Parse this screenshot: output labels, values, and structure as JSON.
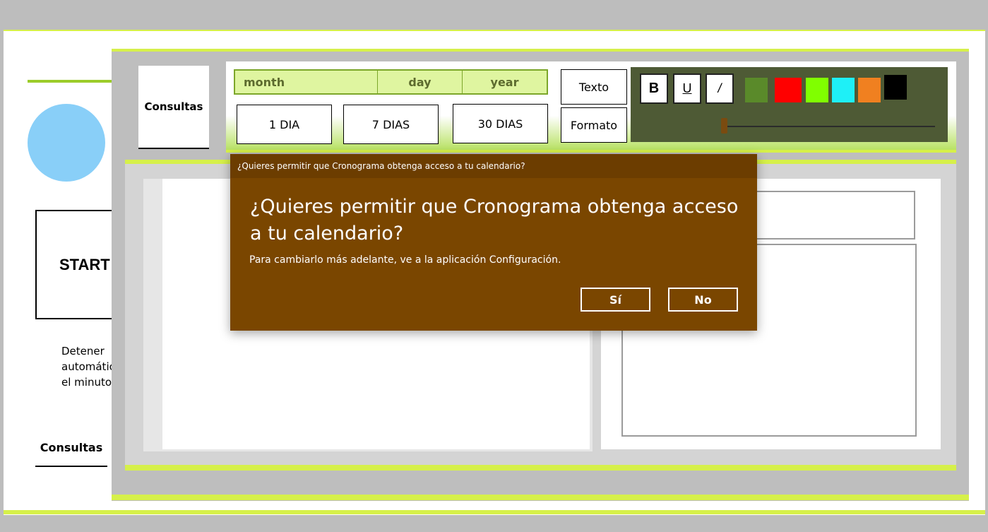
{
  "left_nav": {
    "start_label": "START",
    "stop_text": "Detener automático en el minuto",
    "consultas_label": "Consultas"
  },
  "panel": {
    "consultas_label": "Consultas"
  },
  "toolbar": {
    "date": {
      "month": "month",
      "day": "day",
      "year": "year"
    },
    "ranges": {
      "one_day": "1 DIA",
      "seven_days": "7 DIAS",
      "thirty_days": "30 DIAS"
    },
    "texto_label": "Texto",
    "formato_label": "Formato",
    "format_buttons": {
      "bold": "B",
      "underline": "U",
      "italic": "/"
    },
    "swatches": [
      "#5a8a2a",
      "#ff0000",
      "#80ff00",
      "#1ef0f7",
      "#f08020",
      "#000000"
    ],
    "slider_value": 0
  },
  "dialog": {
    "title": "¿Quieres permitir que Cronograma obtenga acceso a tu calendario?",
    "heading": "¿Quieres permitir que Cronograma obtenga acceso a tu calendario?",
    "message": "Para cambiarlo más adelante, ve a la aplicación Configuración.",
    "yes_label": "Sí",
    "no_label": "No"
  }
}
